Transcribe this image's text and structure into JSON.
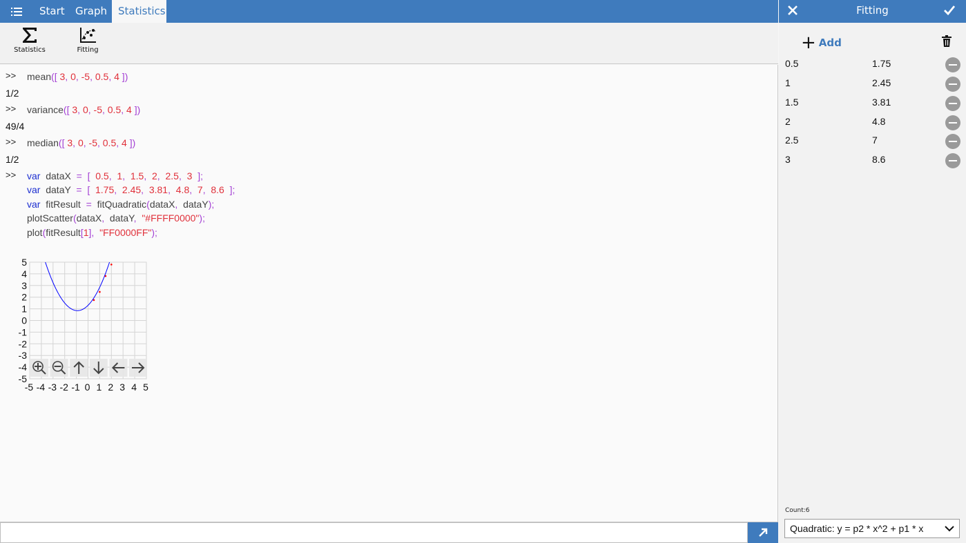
{
  "nav": {
    "tabs": [
      "Start",
      "Graph",
      "Statistics"
    ],
    "active_tab": "Statistics"
  },
  "ribbon": {
    "statistics_label": "Statistics",
    "fitting_label": "Fitting"
  },
  "console": {
    "prompt": ">>",
    "entries": [
      {
        "fn": "mean",
        "args": [
          "3",
          "0",
          "-5",
          "0.5",
          "4"
        ],
        "result": "1/2"
      },
      {
        "fn": "variance",
        "args": [
          "3",
          "0",
          "-5",
          "0.5",
          "4"
        ],
        "result": "49/4"
      },
      {
        "fn": "median",
        "args": [
          "3",
          "0",
          "-5",
          "0.5",
          "4"
        ],
        "result": "1/2"
      }
    ],
    "script": {
      "kw": "var",
      "dataX_name": "dataX",
      "dataX_values": [
        "0.5",
        "1",
        "1.5",
        "2",
        "2.5",
        "3"
      ],
      "dataY_name": "dataY",
      "dataY_values": [
        "1.75",
        "2.45",
        "3.81",
        "4.8",
        "7",
        "8.6"
      ],
      "fit_var": "fitResult",
      "fit_fn": "fitQuadratic",
      "scatter_fn": "plotScatter",
      "scatter_color": "\"#FFFF0000\"",
      "plot_fn": "plot",
      "plot_index": "1",
      "plot_color": "\"FF0000FF\""
    },
    "input_value": ""
  },
  "chart_data": {
    "type": "scatter",
    "xlim": [
      -5,
      5
    ],
    "ylim": [
      -5,
      5
    ],
    "x_ticks": [
      "-5",
      "-4",
      "-3",
      "-2",
      "-1",
      "0",
      "1",
      "2",
      "3",
      "4",
      "5"
    ],
    "y_ticks": [
      "5",
      "4",
      "3",
      "2",
      "1",
      "0",
      "-1",
      "-2",
      "-3",
      "-4",
      "-5"
    ],
    "grid": true,
    "series": [
      {
        "kind": "scatter",
        "color": "#FF0000",
        "x": [
          0.5,
          1,
          1.5,
          2,
          2.5,
          3
        ],
        "y": [
          1.75,
          2.45,
          3.81,
          4.8,
          7,
          8.6
        ]
      },
      {
        "kind": "curve",
        "color": "#0000FF",
        "coeffs": [
          0.55,
          1.0,
          1.3
        ]
      }
    ],
    "toolbar": [
      "zoom-in",
      "zoom-out",
      "pan-up",
      "pan-down",
      "pan-left",
      "pan-right"
    ]
  },
  "panel": {
    "title": "Fitting",
    "add_label": "Add",
    "rows": [
      {
        "x": "0.5",
        "y": "1.75"
      },
      {
        "x": "1",
        "y": "2.45"
      },
      {
        "x": "1.5",
        "y": "3.81"
      },
      {
        "x": "2",
        "y": "4.8"
      },
      {
        "x": "2.5",
        "y": "7"
      },
      {
        "x": "3",
        "y": "8.6"
      }
    ],
    "count_label": "Count:6",
    "fit_model": "Quadratic: y = p2 * x^2 + p1 * x"
  },
  "colors": {
    "accent": "#3f7bbd",
    "keyword": "#1d2fd0",
    "number": "#e0303a",
    "paren": "#a33fd4"
  }
}
